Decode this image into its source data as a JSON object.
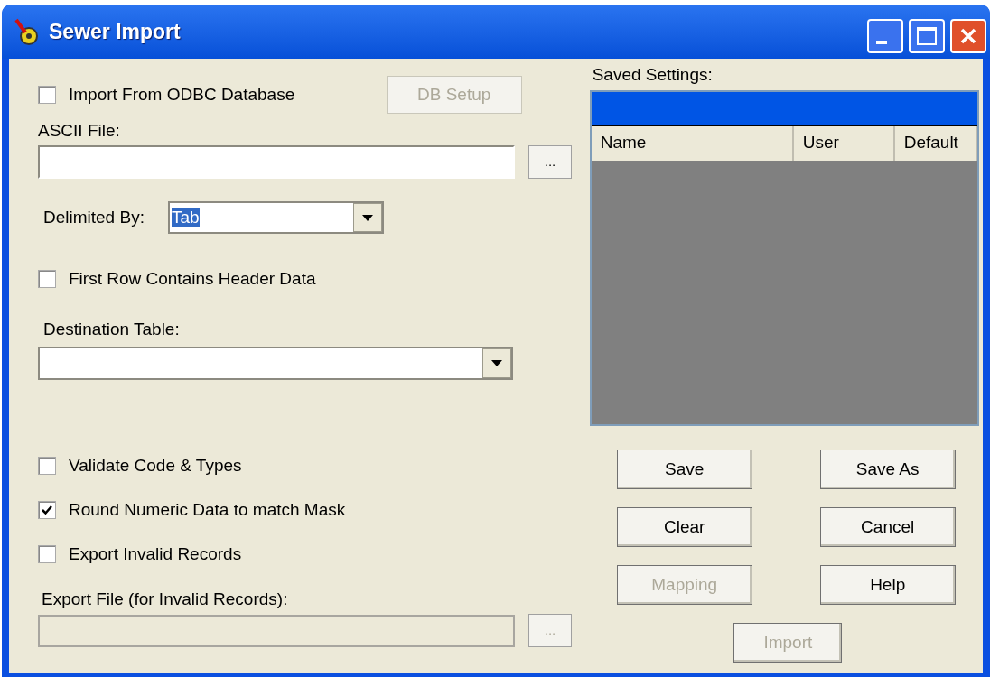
{
  "window": {
    "title": "Sewer Import"
  },
  "import_from_odbc": {
    "label": "Import From ODBC Database",
    "checked": false
  },
  "db_setup_button": {
    "label": "DB Setup",
    "disabled": true
  },
  "ascii_file": {
    "label": "ASCII File:",
    "browse": {
      "label": "...",
      "disabled": false
    }
  },
  "delimited_by": {
    "label": "Delimited By:",
    "value": "Tab",
    "text_selected": true
  },
  "first_row_header": {
    "label": "First Row Contains Header Data",
    "checked": false
  },
  "destination_table": {
    "label": "Destination Table:"
  },
  "options": [
    {
      "label": "Validate Code & Types",
      "checked": false
    },
    {
      "label": "Round Numeric Data to match Mask",
      "checked": true
    },
    {
      "label": "Export Invalid Records",
      "checked": false
    }
  ],
  "export_file": {
    "label": "Export File (for Invalid Records):",
    "disabled": true,
    "browse": {
      "label": "...",
      "disabled": true
    }
  },
  "saved_settings": {
    "label": "Saved Settings:",
    "columns": [
      "Name",
      "User",
      "Default"
    ]
  },
  "buttons": [
    {
      "label": "Save",
      "disabled": false
    },
    {
      "label": "Save As",
      "disabled": false
    },
    {
      "label": "Clear",
      "disabled": false
    },
    {
      "label": "Cancel",
      "disabled": false
    },
    {
      "label": "Mapping",
      "disabled": true
    },
    {
      "label": "Help",
      "disabled": false
    }
  ],
  "import_button": {
    "label": "Import",
    "disabled": true
  }
}
